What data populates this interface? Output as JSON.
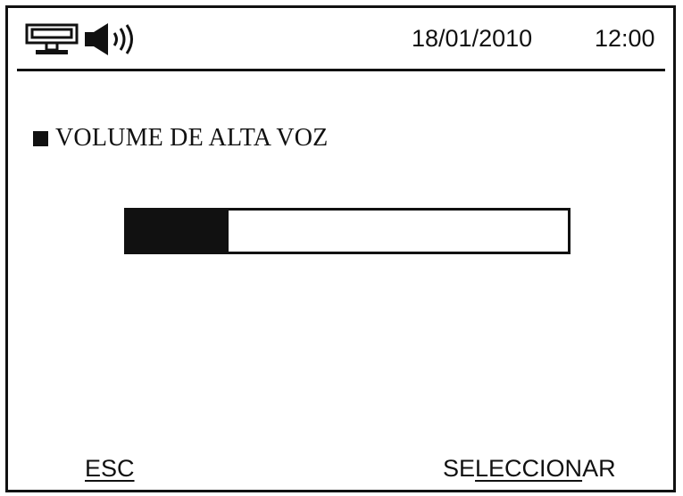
{
  "header": {
    "icons": [
      "network-connection-icon",
      "speaker-volume-icon"
    ],
    "date": "18/01/2010",
    "time": "12:00"
  },
  "menu": {
    "selected_item": "VOLUME DE ALTA VOZ"
  },
  "volume": {
    "level_fraction": 0.23
  },
  "softkeys": {
    "left": "ESC",
    "right_start": "SE",
    "right_underlined": "LECCION",
    "right_end": "AR"
  },
  "colors": {
    "foreground": "#111111",
    "background": "#ffffff"
  }
}
